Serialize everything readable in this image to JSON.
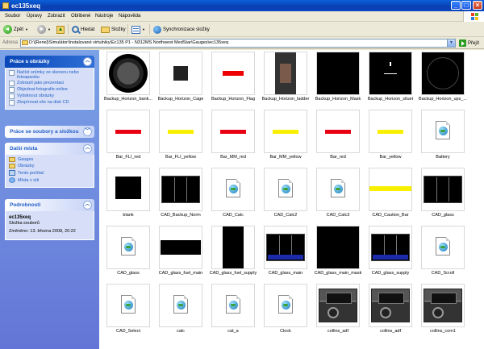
{
  "window": {
    "title": "ec135xeq"
  },
  "menu": [
    "Soubor",
    "Úpravy",
    "Zobrazit",
    "Oblíbené",
    "Nástroje",
    "Nápověda"
  ],
  "toolbar": {
    "back": "Zpět",
    "search": "Hledat",
    "folders": "Složky",
    "sync": "Synchronizace složky"
  },
  "address": {
    "label": "Adresa",
    "path": "D:\\[Rene]\\Simulátor\\Instalované virtulniky\\Ec135 P1 - N312MS Northwest MedStar\\Gauges\\ec135xeq",
    "go": "Přejít"
  },
  "leftpane": {
    "picture_tasks": {
      "title": "Práce s obrázky",
      "items": [
        "Načíst snímky ze skeneru nebo fotoaparátu",
        "Zobrazit jako prezentaci",
        "Objednat fotografie online",
        "Vytisknout obrázky",
        "Zkopírovat vše na disk CD"
      ]
    },
    "file_tasks": {
      "title": "Práce se soubory a složkou"
    },
    "places": {
      "title": "Další místa",
      "items": [
        "Gauges",
        "Obrázky",
        "Tento počítač",
        "Místa v síti"
      ]
    },
    "details": {
      "title": "Podrobnosti",
      "name": "ec135xeq",
      "type": "Složka souborů",
      "modified": "Změněno: 13. března 2008, 20:22"
    }
  },
  "files": [
    {
      "name": "Backup_Horizon_bank...",
      "kind": "gauge"
    },
    {
      "name": "Backup_Horizon_Cage",
      "kind": "cage"
    },
    {
      "name": "Backup_Horizon_Flag",
      "kind": "flag"
    },
    {
      "name": "Backup_Horizon_ladder",
      "kind": "ladder"
    },
    {
      "name": "Backup_Horizon_Mask",
      "kind": "black"
    },
    {
      "name": "Backup_Horizon_siluet",
      "kind": "siluet"
    },
    {
      "name": "Backup_Horizon_ups_...",
      "kind": "ring"
    },
    {
      "name": "Bar_FLI_red",
      "kind": "bar-red"
    },
    {
      "name": "Bar_FLI_yellow",
      "kind": "bar-yellow"
    },
    {
      "name": "Bar_MM_red",
      "kind": "bar-red"
    },
    {
      "name": "Bar_MM_yellow",
      "kind": "bar-yellow"
    },
    {
      "name": "Bar_red",
      "kind": "bar-red"
    },
    {
      "name": "Bar_yellow",
      "kind": "bar-yellow"
    },
    {
      "name": "Battery",
      "kind": "doc"
    },
    {
      "name": "blank",
      "kind": "blank"
    },
    {
      "name": "CAD_Backup_Norm",
      "kind": "screen"
    },
    {
      "name": "CAD_Calc",
      "kind": "doc"
    },
    {
      "name": "CAD_Calc2",
      "kind": "doc"
    },
    {
      "name": "CAD_Calc3",
      "kind": "doc"
    },
    {
      "name": "CAD_Caution_Bar",
      "kind": "caution"
    },
    {
      "name": "CAD_glass",
      "kind": "screen"
    },
    {
      "name": "CAD_glass",
      "kind": "doc"
    },
    {
      "name": "CAD_glass_fuel_main",
      "kind": "wide-black"
    },
    {
      "name": "CAD_glass_fuel_supply",
      "kind": "tall-black"
    },
    {
      "name": "CAD_glass_main",
      "kind": "screen-blue"
    },
    {
      "name": "CAD_glass_main_mask",
      "kind": "black"
    },
    {
      "name": "CAD_glass_supply",
      "kind": "screen-blue"
    },
    {
      "name": "CAD_Scroll",
      "kind": "doc"
    },
    {
      "name": "CAD_Select",
      "kind": "doc"
    },
    {
      "name": "calc",
      "kind": "doc"
    },
    {
      "name": "cat_a",
      "kind": "doc"
    },
    {
      "name": "Clock",
      "kind": "doc"
    },
    {
      "name": "collins_adf",
      "kind": "panel"
    },
    {
      "name": "collins_adf",
      "kind": "panel"
    },
    {
      "name": "collins_com1",
      "kind": "panel"
    }
  ]
}
